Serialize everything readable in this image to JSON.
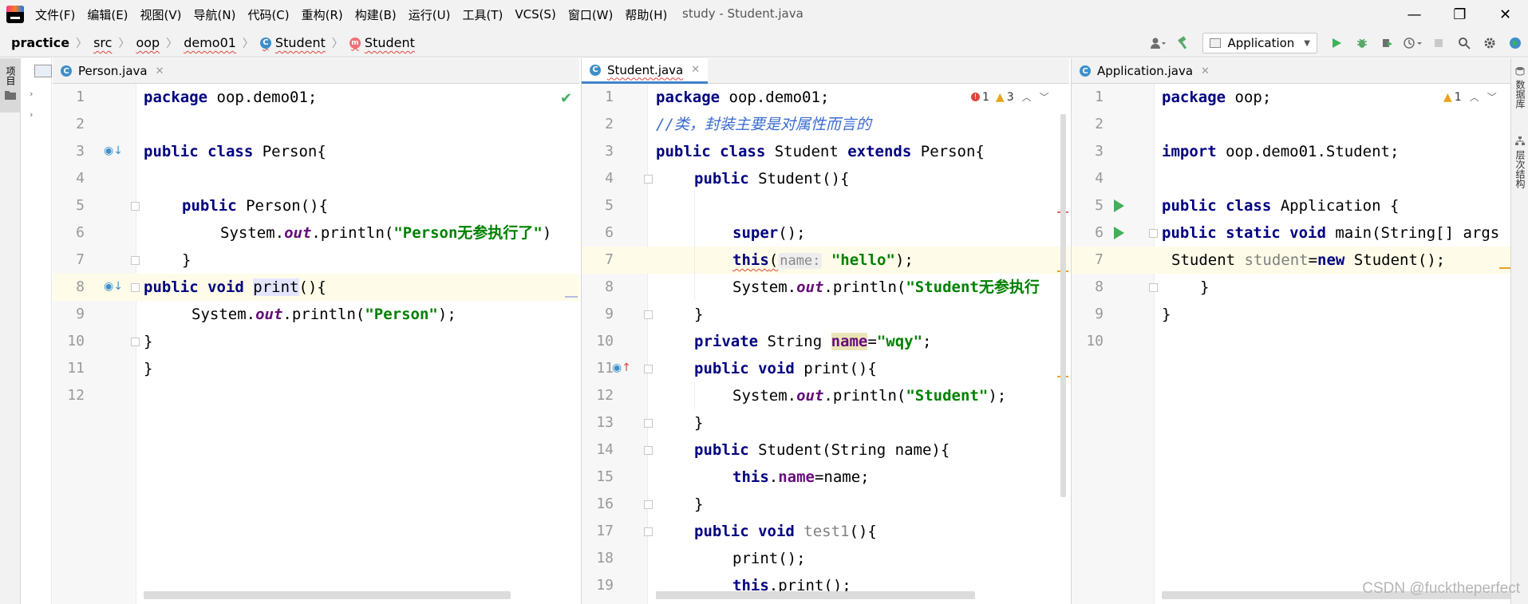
{
  "menu": [
    "文件(F)",
    "编辑(E)",
    "视图(V)",
    "导航(N)",
    "代码(C)",
    "重构(R)",
    "构建(B)",
    "运行(U)",
    "工具(T)",
    "VCS(S)",
    "窗口(W)",
    "帮助(H)"
  ],
  "window_title": "study - Student.java",
  "window_controls": {
    "minimize": "—",
    "restore": "❐",
    "close": "✕"
  },
  "breadcrumb": {
    "project": "practice",
    "items": [
      "src",
      "oop",
      "demo01"
    ],
    "class_name": "Student",
    "method_name": "Student",
    "class_badge": "C",
    "method_badge": "m"
  },
  "toolbar": {
    "run_config": "Application"
  },
  "left_strip": {
    "project_tab": "项目"
  },
  "right_strip": {
    "tab1": "数据库",
    "tab2": "层次结构"
  },
  "panes": {
    "left": {
      "tab_label": "Person.java",
      "lines": [
        "1",
        "2",
        "3",
        "4",
        "5",
        "6",
        "7",
        "8",
        "9",
        "10",
        "11",
        "12"
      ],
      "code": {
        "l1_kw": "package",
        "l1_rest": " oop.demo01;",
        "l3_kw": "public class",
        "l3_rest": " Person{",
        "l5_kw": "public",
        "l5_rest": " Person(){",
        "l6_a": "System.",
        "l6_out": "out",
        "l6_b": ".println(",
        "l6_str": "\"Person无参执行了\"",
        "l6_c": ")",
        "l7": "}",
        "l8_kw": "public void",
        "l8_sp": " ",
        "l8_sel": "print",
        "l8_rest": "(){",
        "l9_a": "System.",
        "l9_out": "out",
        "l9_b": ".println(",
        "l9_str": "\"Person\"",
        "l9_c": ");",
        "l10": "}",
        "l11": "}"
      }
    },
    "middle": {
      "tab_label": "Student.java",
      "errors": "1",
      "warnings": "3",
      "lines": [
        "1",
        "2",
        "3",
        "4",
        "5",
        "6",
        "7",
        "8",
        "9",
        "10",
        "11",
        "12",
        "13",
        "14",
        "15",
        "16",
        "17",
        "18",
        "19"
      ],
      "code": {
        "l1_kw": "package",
        "l1_rest": " oop.demo01;",
        "l2": "//类，封装主要是对属性而言的",
        "l3_kw1": "public class",
        "l3_mid": " Student ",
        "l3_kw2": "extends",
        "l3_rest": " Person{",
        "l4_kw": "public",
        "l4_rest": " Student(){",
        "l6_kw": "super",
        "l6_rest": "();",
        "l7_kw": "this",
        "l7_a": "(",
        "l7_hint": "name:",
        "l7_str": "\"hello\"",
        "l7_rest": ");",
        "l8_a": "System.",
        "l8_out": "out",
        "l8_b": ".println(",
        "l8_str": "\"Student无参执行",
        "l9": "}",
        "l10_kw": "private",
        "l10_a": " String ",
        "l10_name": "name",
        "l10_b": "=",
        "l10_str": "\"wqy\"",
        "l10_c": ";",
        "l11_kw": "public void",
        "l11_rest": " print(){",
        "l12_a": "System.",
        "l12_out": "out",
        "l12_b": ".println(",
        "l12_str": "\"Student\"",
        "l12_c": ");",
        "l13": "}",
        "l14_kw": "public",
        "l14_rest": " Student(String name){",
        "l15_kw": "this",
        "l15_a": ".",
        "l15_field": "name",
        "l15_rest": "=name;",
        "l16": "}",
        "l17_kw": "public void",
        "l17_sp": " ",
        "l17_name": "test1",
        "l17_rest": "(){",
        "l18": "print();",
        "l19_kw": "this",
        "l19_rest": ".print();"
      }
    },
    "right": {
      "tab_label": "Application.java",
      "warnings": "1",
      "lines": [
        "1",
        "2",
        "3",
        "4",
        "5",
        "6",
        "7",
        "8",
        "9",
        "10"
      ],
      "code": {
        "l1_kw": "package",
        "l1_rest": " oop;",
        "l3_kw": "import",
        "l3_rest": " oop.demo01.Student;",
        "l5_kw": "public class",
        "l5_rest": " Application {",
        "l6_kw": "public static void",
        "l6_rest": " main(String[] args",
        "l7_a": "Student ",
        "l7_var": "student",
        "l7_b": "=",
        "l7_kw": "new",
        "l7_rest": " Student();",
        "l8": "}",
        "l9": "}"
      }
    }
  },
  "watermark": "CSDN @fucktheperfect",
  "colors": {
    "keyword": "#000080",
    "string": "#008000",
    "comment": "#3b6ccf",
    "field": "#660e7a",
    "accent": "#4083c9"
  }
}
